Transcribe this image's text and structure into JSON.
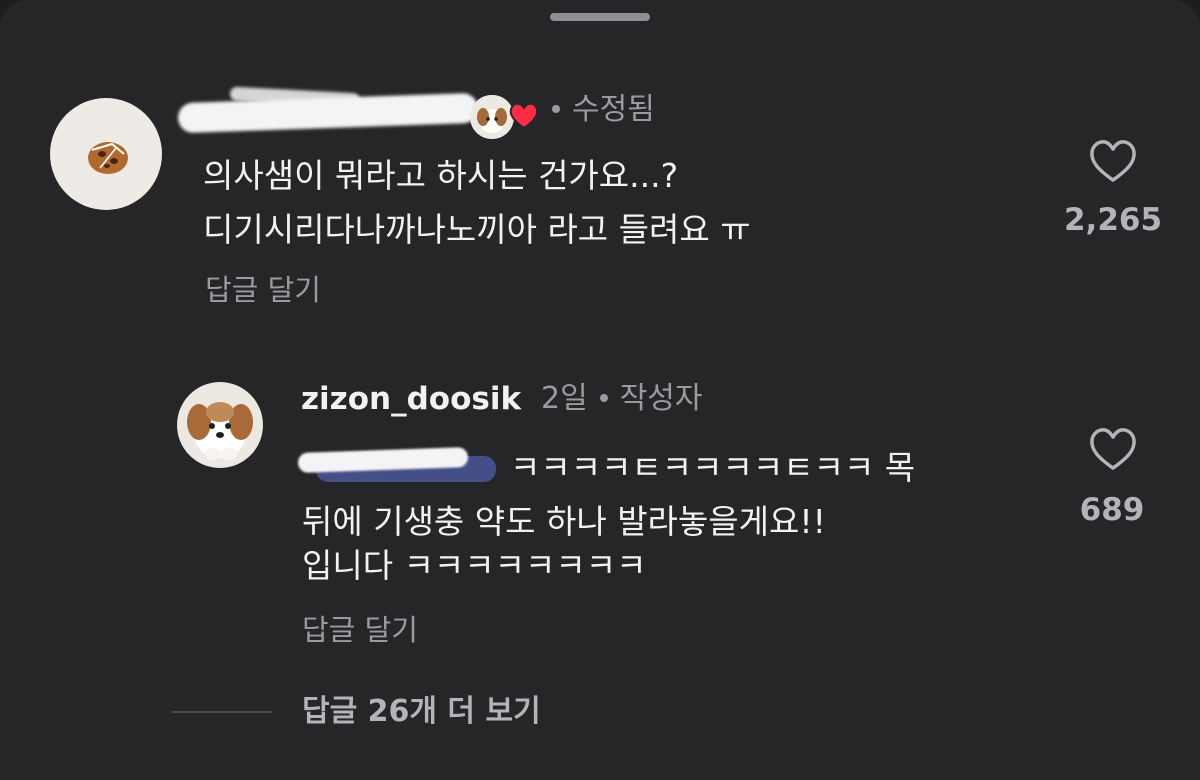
{
  "comment": {
    "edited_label": "수정됨",
    "line1": "의사샘이 뭐라고 하시는 건가요...?",
    "line2": "디기시리다나까나노끼아 라고 들려요 ㅠ",
    "reply_label": "답글 달기",
    "likes": "2,265"
  },
  "reply": {
    "username": "zizon_doosik",
    "time": "2일",
    "author_label": "작성자",
    "line1_rest": "ㅋㅋㅋㅋㅌㅋㅋㅋㅋㅌㅋㅋ 목",
    "line2": "뒤에 기생충 약도 하나 발라놓을게요!!",
    "line3": "입니다 ㅋㅋㅋㅋㅋㅋㅋㅋ",
    "reply_label": "답글 달기",
    "likes": "689"
  },
  "more_replies": "답글 26개 더 보기",
  "colors": {
    "background": "#262628",
    "text": "#f2f2f2",
    "muted": "#9a9a9f",
    "heart_badge": "#ff2d44",
    "mention": "#5c6fd6"
  }
}
